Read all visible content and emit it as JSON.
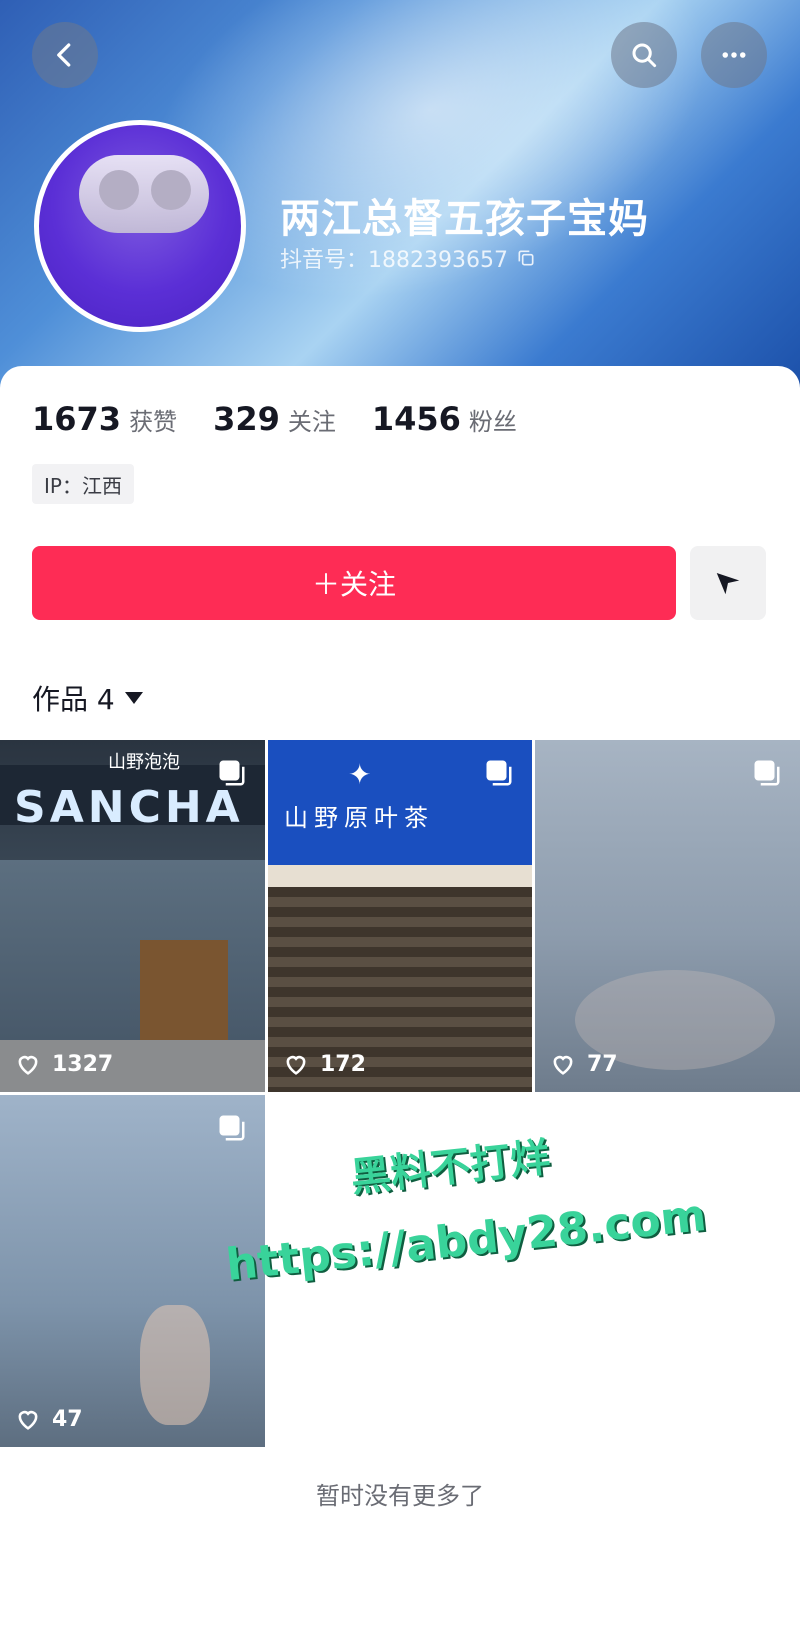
{
  "profile": {
    "nickname": "两江总督五孩子宝妈",
    "douyin_id": "抖音号：1882393657",
    "ip": "IP：江西"
  },
  "stats": [
    {
      "num": "1673",
      "label": "获赞"
    },
    {
      "num": "329",
      "label": "关注"
    },
    {
      "num": "1456",
      "label": "粉丝"
    }
  ],
  "actions": {
    "follow_label": "＋关注"
  },
  "works": {
    "tab_label": "作品 4",
    "items": [
      {
        "likes": "1327",
        "sign_brand": "山野泡泡",
        "sign_text": "SANCHA"
      },
      {
        "likes": "172",
        "sign_text": "山野原叶茶"
      },
      {
        "likes": "77"
      },
      {
        "likes": "47"
      }
    ]
  },
  "watermark": {
    "line1": "黑料不打烊",
    "line2": "https://abdy28.com"
  },
  "footer": {
    "end_note": "暂时没有更多了"
  },
  "colors": {
    "accent": "#fe2c55",
    "watermark": "#39d39a"
  }
}
